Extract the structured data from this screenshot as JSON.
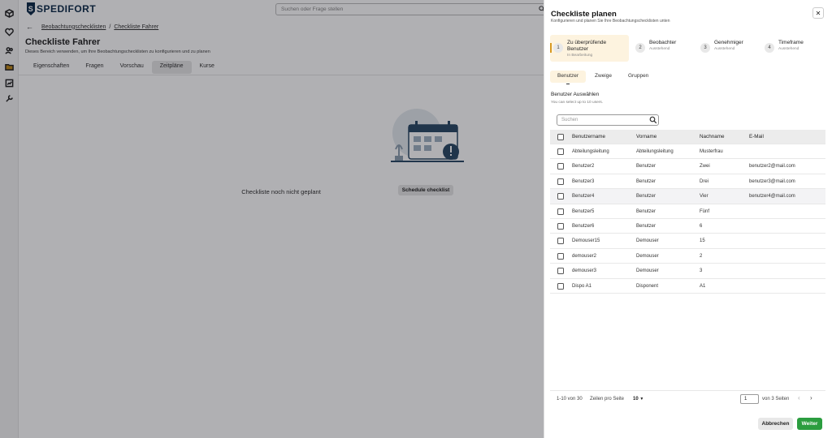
{
  "app": {
    "brand": "SPEDIFORT",
    "brand_mark": "S",
    "accent": "#2b9d3f",
    "brand_color": "#0f2d4a"
  },
  "topbar": {
    "search_placeholder": "Suchen oder Frage stellen"
  },
  "rail": {
    "icons": [
      "cube-icon",
      "heart-icon",
      "users-icon",
      "folder-icon",
      "chart-icon",
      "wrench-icon"
    ]
  },
  "page": {
    "breadcrumb": {
      "parent": "Beobachtungschecklisten",
      "separator": "/",
      "current": "Checkliste Fahrer"
    },
    "title": "Checkliste Fahrer",
    "subtitle": "Dieses Bereich verwenden, um Ihre Beobachtungschecklisten zu konfigurieren und zu planen",
    "tabs": [
      "Eigenschaften",
      "Fragen",
      "Vorschau",
      "Zeitpläne",
      "Kurse"
    ],
    "active_tab": "Zeitpläne",
    "empty_text": "Checkliste noch nicht geplant",
    "schedule_button": "Schedule checklist"
  },
  "drawer": {
    "title": "Checkliste planen",
    "subtitle": "Konfigurieren und planen Sie Ihre Beobachtungschecklisten unten",
    "steps": [
      {
        "num": "1",
        "name": "Zu überprüfende Benutzer",
        "state": "In Bearbeitung",
        "active": true
      },
      {
        "num": "2",
        "name": "Beobachter",
        "state": "Ausstehend"
      },
      {
        "num": "3",
        "name": "Genehmiger",
        "state": "Ausstehend"
      },
      {
        "num": "4",
        "name": "Timeframe",
        "state": "Ausstehend"
      }
    ],
    "subtabs": [
      "Benutzer",
      "Zweige",
      "Gruppen"
    ],
    "select_title": "Benutzer Auswählen",
    "select_hint": "You can select up to 10 users.",
    "search_placeholder": "Suchen",
    "table": {
      "headers": [
        "Benutzername",
        "Vorname",
        "Nachname",
        "E-Mail"
      ],
      "rows": [
        [
          "Abteilungsleitung",
          "Abteilungsleitung",
          "Musterfrau",
          ""
        ],
        [
          "Benutzer2",
          "Benutzer",
          "Zwei",
          "benutzer2@mail.com"
        ],
        [
          "Benutzer3",
          "Benutzer",
          "Drei",
          "benutzer3@mail.com"
        ],
        [
          "Benutzer4",
          "Benutzer",
          "Vier",
          "benutzer4@mail.com"
        ],
        [
          "Benutzer5",
          "Benutzer",
          "Fünf",
          ""
        ],
        [
          "Benutzer6",
          "Benutzer",
          "6",
          ""
        ],
        [
          "Demouser15",
          "Demouser",
          "15",
          ""
        ],
        [
          "demouser2",
          "Demouser",
          "2",
          ""
        ],
        [
          "demouser3",
          "Demouser",
          "3",
          ""
        ],
        [
          "Dispo A1",
          "Disponent",
          "A1",
          ""
        ]
      ]
    },
    "pagination": {
      "range": "1-10 von 30",
      "rows_label": "Zeilen pro Seite",
      "rows_value": "10",
      "page": "1",
      "of_pages": "von 3 Seiten"
    },
    "cancel_button": "Abbrechen",
    "next_button": "Weiter"
  }
}
